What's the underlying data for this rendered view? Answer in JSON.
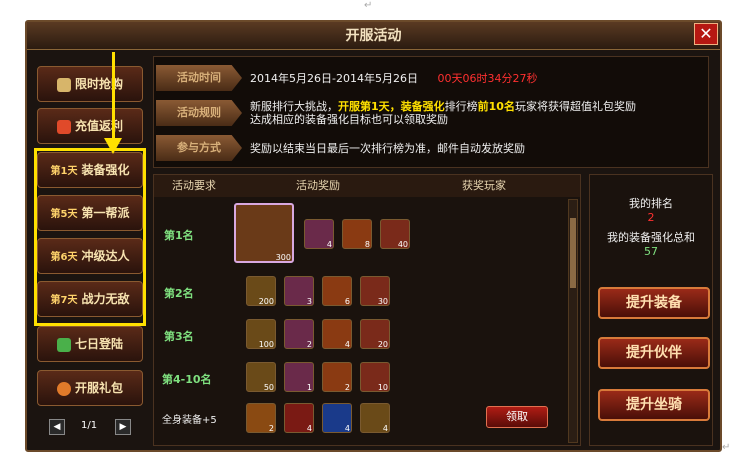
{
  "window": {
    "title": "开服活动",
    "close_label": "✕"
  },
  "sidebar": {
    "items": [
      {
        "label": "限时抢购",
        "day": ""
      },
      {
        "label": "充值返利",
        "day": ""
      },
      {
        "label": "装备强化",
        "day": "第1天"
      },
      {
        "label": "第一帮派",
        "day": "第5天"
      },
      {
        "label": "冲级达人",
        "day": "第6天"
      },
      {
        "label": "战力无敌",
        "day": "第7天"
      },
      {
        "label": "七日登陆",
        "day": ""
      },
      {
        "label": "开服礼包",
        "day": ""
      }
    ],
    "pager": {
      "text": "1/1",
      "prev": "◀",
      "next": "▶"
    }
  },
  "info": {
    "time_tag": "活动时间",
    "time_text": "2014年5月26日-2014年5月26日",
    "countdown": "00天06时34分27秒",
    "rule_tag": "活动规则",
    "rule_line1_a": "新服排行大挑战，",
    "rule_line1_b": "开服第1天，装备强化",
    "rule_line1_c": "排行榜",
    "rule_line1_d": "前10名",
    "rule_line1_e": "玩家将获得超值礼包奖励",
    "rule_line2": "达成相应的装备强化目标也可以领取奖励",
    "method_tag": "参与方式",
    "method_text": "奖励以结束当日最后一次排行榜为准，邮件自动发放奖励"
  },
  "table": {
    "headers": [
      "活动要求",
      "活动奖励",
      "获奖玩家"
    ],
    "rows": [
      {
        "rank": "第1名",
        "items": [
          "300",
          "4",
          "8",
          "40"
        ]
      },
      {
        "rank": "第2名",
        "items": [
          "200",
          "3",
          "6",
          "30"
        ]
      },
      {
        "rank": "第3名",
        "items": [
          "100",
          "2",
          "4",
          "20"
        ]
      },
      {
        "rank": "第4-10名",
        "items": [
          "50",
          "1",
          "2",
          "10"
        ]
      },
      {
        "rank": "全身装备+5",
        "items": [
          "2",
          "4",
          "4",
          "4"
        ]
      }
    ],
    "claim_label": "领取"
  },
  "right_panel": {
    "my_rank_label": "我的排名",
    "my_rank_value": "2",
    "my_total_label": "我的装备强化总和",
    "my_total_value": "57",
    "btn_equip": "提升装备",
    "btn_partner": "提升伙伴",
    "btn_mount": "提升坐骑"
  },
  "colors": {
    "accent": "#ffe000",
    "highlight_red": "#ff3030",
    "rank_green": "#7fe07f"
  }
}
